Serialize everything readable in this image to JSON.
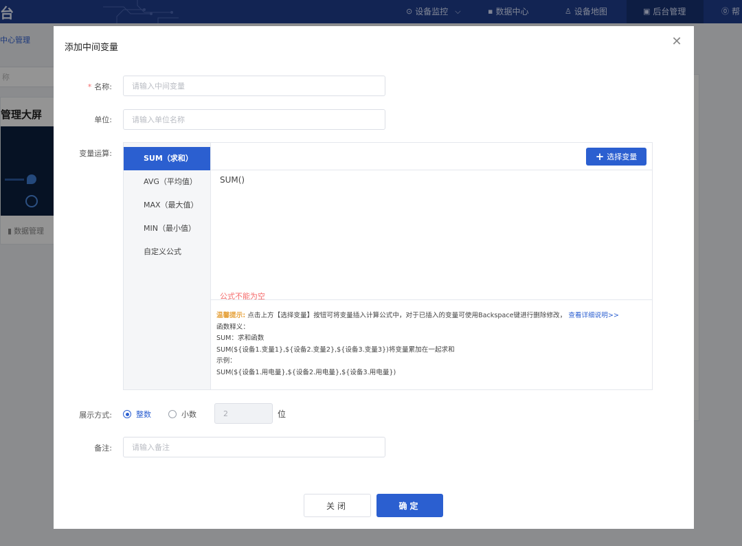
{
  "topbar": {
    "brand": "台",
    "nav": [
      {
        "label": "设备监控",
        "icon": "location-icon",
        "has_caret": true
      },
      {
        "label": "数据中心",
        "icon": "bar-chart-icon"
      },
      {
        "label": "设备地图",
        "icon": "user-icon"
      },
      {
        "label": "后台管理",
        "icon": "monitor-icon",
        "active": true
      },
      {
        "label": "帮",
        "icon": "help-icon"
      }
    ]
  },
  "background": {
    "tab": "中心管理",
    "search_placeholder": "称",
    "card_title": "管理大屏",
    "card_link": "数据管理"
  },
  "dialog": {
    "title": "添加中间变量",
    "name": {
      "label": "名称:",
      "placeholder": "请输入中间变量",
      "value": ""
    },
    "unit": {
      "label": "单位:",
      "placeholder": "请输入单位名称",
      "value": ""
    },
    "operation": {
      "label": "变量运算:",
      "functions": [
        {
          "label": "SUM（求和）",
          "active": true
        },
        {
          "label": "AVG（平均值）"
        },
        {
          "label": "MAX（最大值）"
        },
        {
          "label": "MIN（最小值）"
        },
        {
          "label": "自定义公式"
        }
      ],
      "select_button": "选择变量",
      "formula": "SUM()",
      "error": "公式不能为空",
      "hint": {
        "warn_label": "温馨提示:",
        "text": "点击上方【选择变量】按钮可将变量插入计算公式中，对于已插入的变量可使用Backspace键进行删除修改，",
        "link": "查看详细说明>>",
        "lines": [
          "函数释义：",
          "SUM：求和函数",
          "SUM(${设备1.变量1},${设备2.变量2},${设备3.变量3})将变量累加在一起求和",
          "示例：",
          "SUM(${设备1.用电量},${设备2.用电量},${设备3.用电量})"
        ]
      }
    },
    "display": {
      "label": "展示方式:",
      "options": [
        {
          "label": "整数",
          "checked": true
        },
        {
          "label": "小数",
          "checked": false
        }
      ],
      "decimals": "2",
      "unit_label": "位"
    },
    "remark": {
      "label": "备注:",
      "placeholder": "请输入备注",
      "value": ""
    },
    "buttons": {
      "close": "关闭",
      "ok": "确定"
    }
  },
  "colors": {
    "primary": "#2b5fd0",
    "nav_bg": "#1f3f8f",
    "error": "#f56c6c",
    "warning": "#e6a23c"
  }
}
